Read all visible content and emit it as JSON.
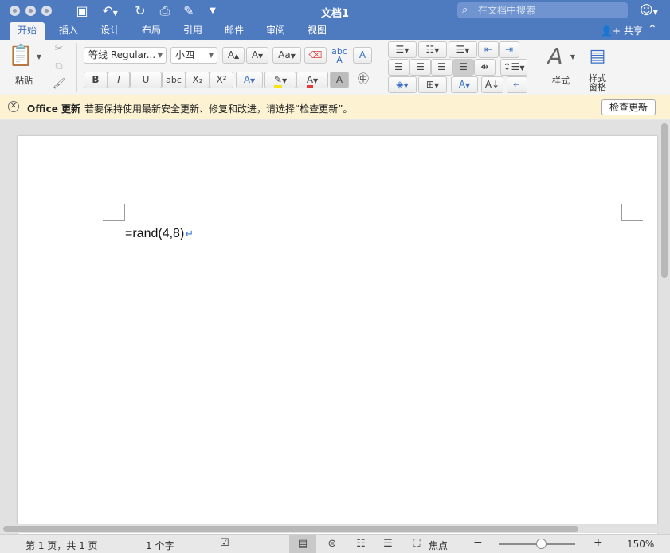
{
  "window": {
    "title": "文档1",
    "search_placeholder": "在文档中搜索"
  },
  "tabs": [
    {
      "label": "开始",
      "active": true
    },
    {
      "label": "插入"
    },
    {
      "label": "设计"
    },
    {
      "label": "布局"
    },
    {
      "label": "引用"
    },
    {
      "label": "邮件"
    },
    {
      "label": "审阅"
    },
    {
      "label": "视图"
    }
  ],
  "share_label": "共享",
  "ribbon": {
    "paste_label": "粘贴",
    "font_name": "等线 Regular...",
    "font_size": "小四",
    "bold": "B",
    "italic": "I",
    "underline": "U",
    "strikethrough": "abc",
    "subscript": "X₂",
    "superscript": "X²",
    "styles_label": "样式",
    "styles_pane_label": "样式\n窗格"
  },
  "notice": {
    "product": "Office 更新",
    "message": "若要保持使用最新安全更新、修复和改进，请选择“检查更新”。",
    "button": "检查更新"
  },
  "document": {
    "text": "=rand(4,8)",
    "paragraph_mark": "↵"
  },
  "status": {
    "page": "第 1 页，共 1 页",
    "words": "1 个字",
    "focus": "焦点",
    "zoom": "150%",
    "zoom_level_fraction": 0.55
  },
  "colors": {
    "titlebar": "#4e7ac0",
    "notice_bg": "#fdf3d2",
    "highlight": "#f5e31c",
    "font_color": "#e23b3b"
  }
}
